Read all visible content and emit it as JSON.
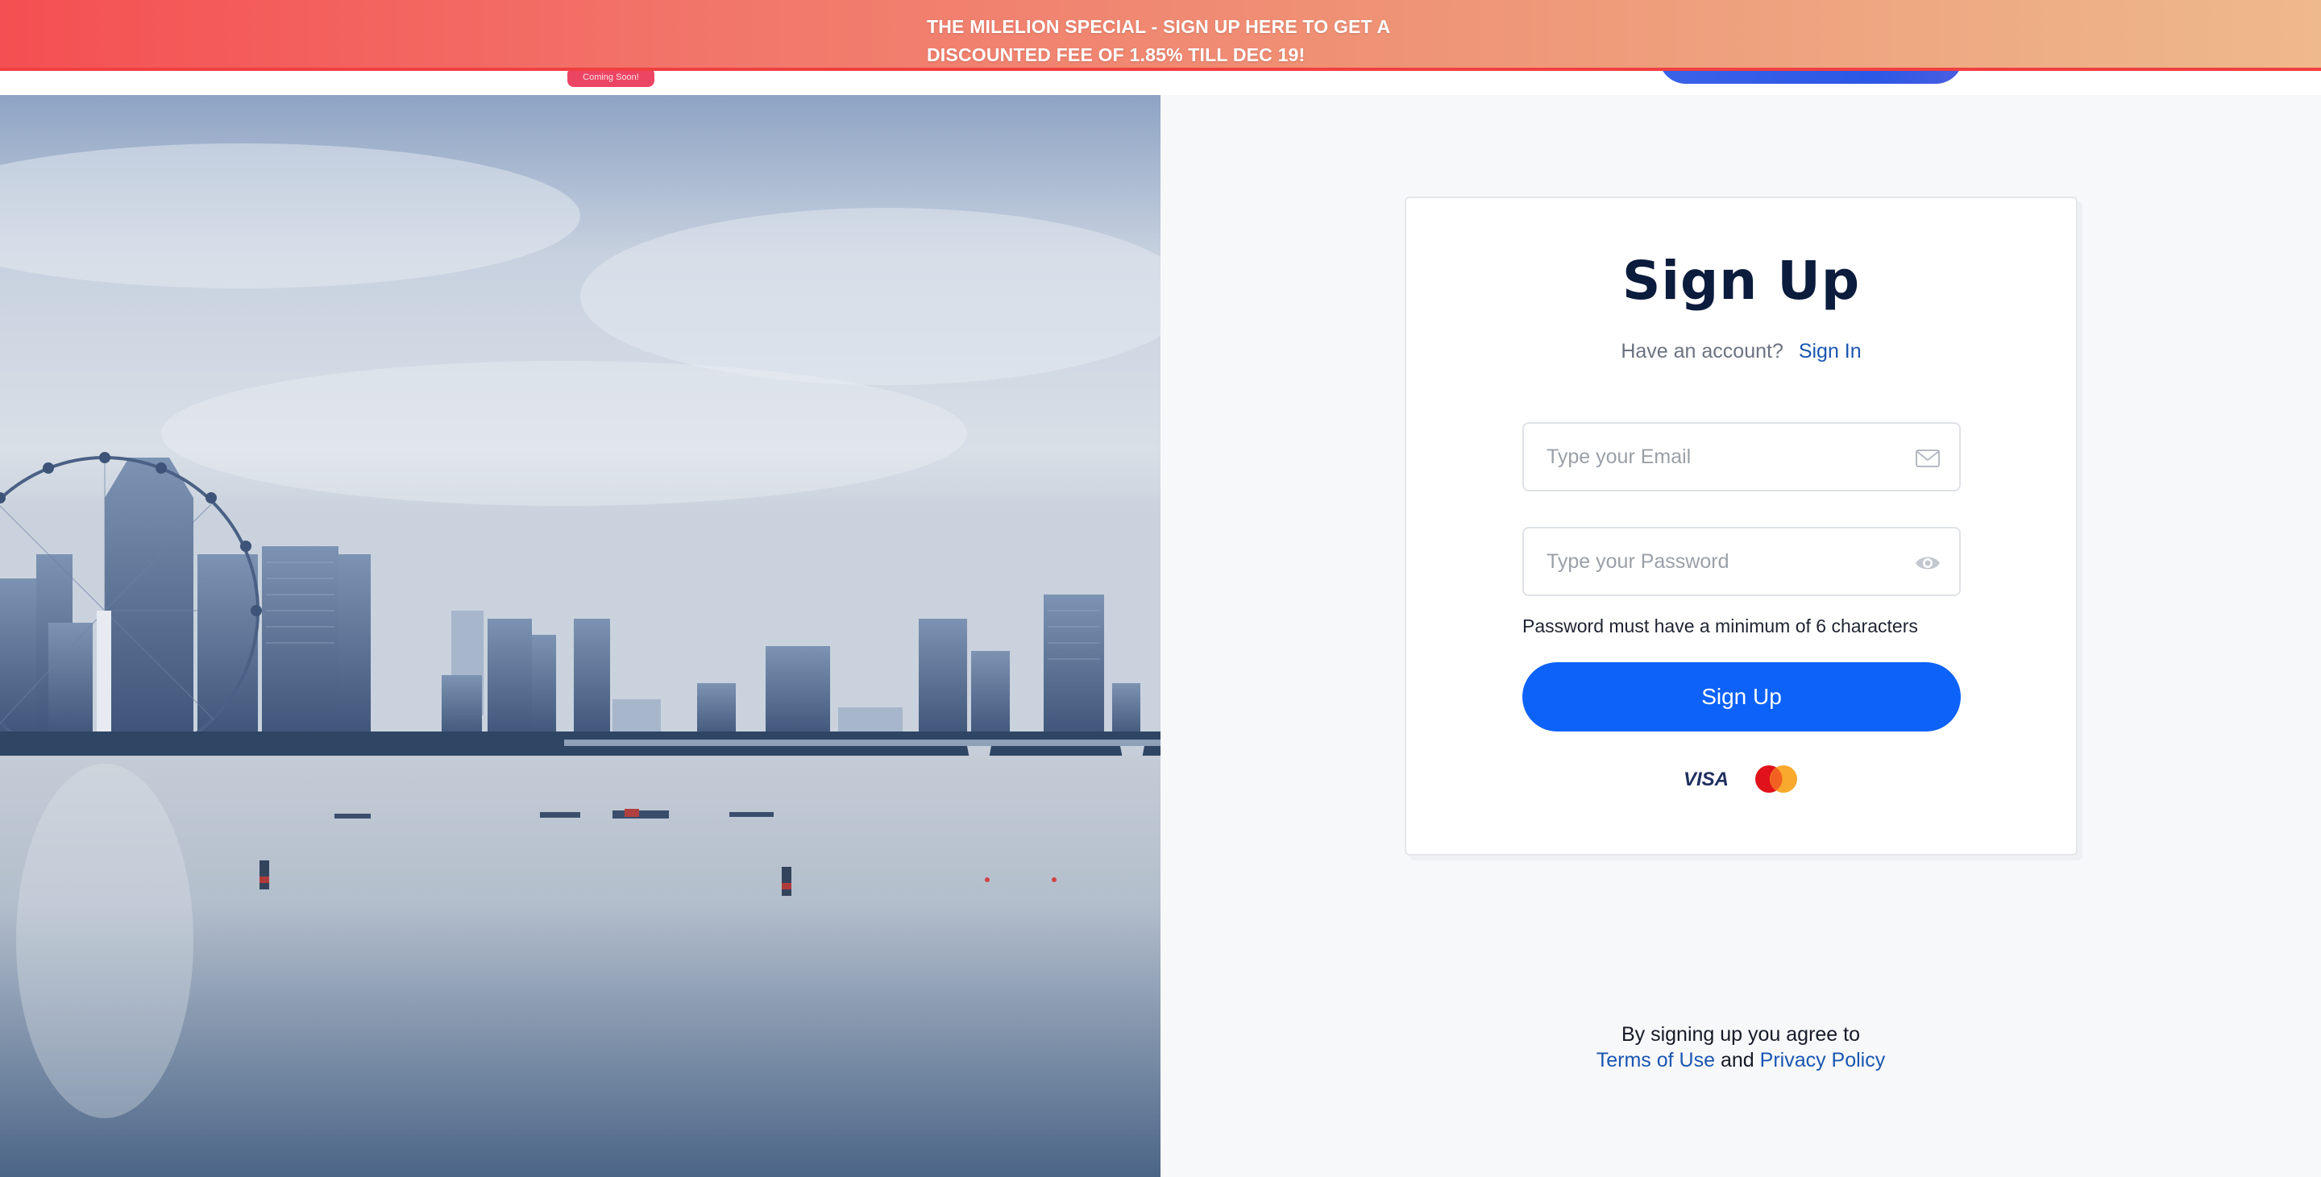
{
  "promo": {
    "line1": "THE MILELION SPECIAL - SIGN UP HERE TO GET A",
    "line2": "DISCOUNTED FEE OF 1.85% TILL DEC 19!"
  },
  "header": {
    "badge": "Coming Soon!"
  },
  "signup": {
    "title": "Sign Up",
    "account_question": "Have an account?",
    "signin_link": "Sign In",
    "email_placeholder": "Type your Email",
    "password_placeholder": "Type your Password",
    "password_hint": "Password must have a minimum of 6 characters",
    "submit_label": "Sign Up",
    "payment_icons": [
      "visa-icon",
      "mastercard-icon"
    ]
  },
  "terms": {
    "prefix": "By signing up you agree to",
    "terms_link": "Terms of Use",
    "conjunction": "and",
    "privacy_link": "Privacy Policy"
  },
  "colors": {
    "primary": "#0d62f9",
    "link": "#1a56b0",
    "title": "#0b1c3d",
    "banner_start": "#f44f52",
    "banner_end": "#eeb98c"
  }
}
